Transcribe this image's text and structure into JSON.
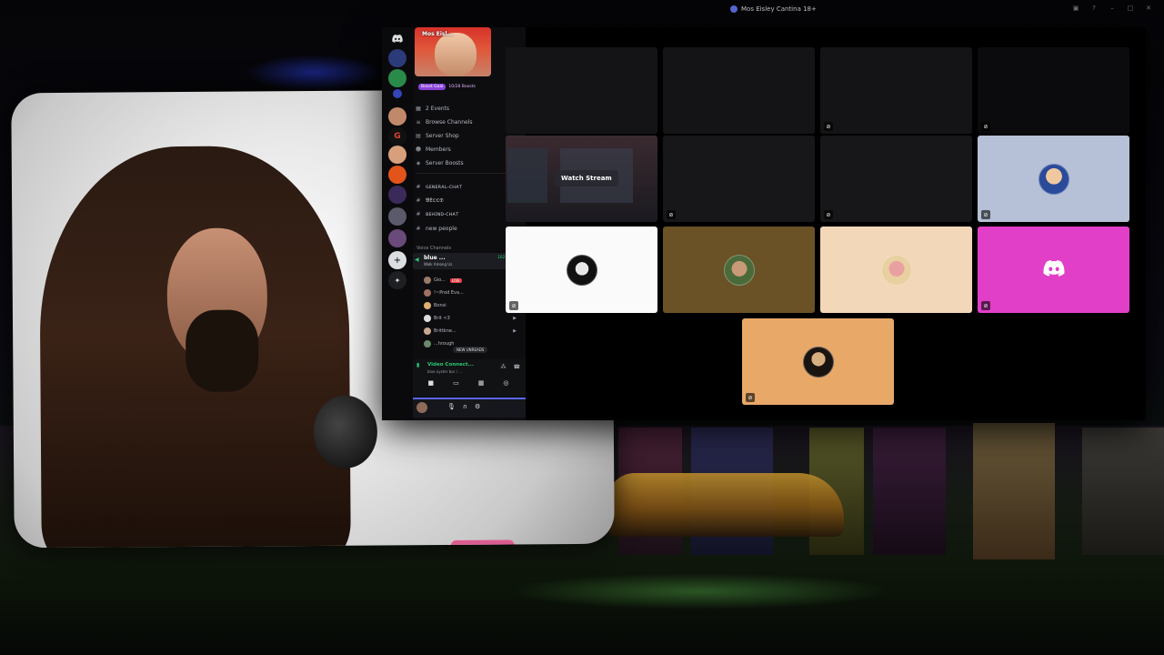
{
  "window": {
    "title": "Mos Eisley Cantina 18+"
  },
  "server": {
    "banner_name": "Mos Eisl...",
    "boost_goal": "Boost Goal",
    "boost_count": "10/28 Boosts"
  },
  "menu": [
    {
      "icon": "calendar-icon",
      "label": "2 Events"
    },
    {
      "icon": "browse-icon",
      "label": "Browse Channels"
    },
    {
      "icon": "shop-icon",
      "label": "Server Shop"
    },
    {
      "icon": "members-icon",
      "label": "Members"
    },
    {
      "icon": "boost-icon",
      "label": "Server Boosts"
    }
  ],
  "text_channels": [
    {
      "label": "ɢᴇɴᴇʀᴀʟ-ᴄʜᴀᴛ"
    },
    {
      "label": "𝕭𝕷𝕺𝕺𝕯"
    },
    {
      "label": "ʙᴇʜɪɴᴅ-ᴄʜᴀᴛ"
    },
    {
      "label": "new people"
    }
  ],
  "voice_section": {
    "title": "Voice Channels",
    "channel_name": "blue ...",
    "channel_sub": "Walk Among Us",
    "timer": "102:30:12"
  },
  "voice_users": [
    {
      "name": "Gio...",
      "live": "LIVE"
    },
    {
      "name": "!~Prod Eva..."
    },
    {
      "name": "Bonsi"
    },
    {
      "name": "Brit <3"
    },
    {
      "name": "Brittkne..."
    },
    {
      "name": "...hrough"
    }
  ],
  "new_unreads": "NEW UNREADS",
  "voice_status": {
    "title": "Video Connect...",
    "subtitle": "blue oyster bar / ..."
  },
  "grid": {
    "watch_stream": "Watch Stream"
  },
  "colors": {
    "accent": "#5865f2",
    "online": "#2dc770",
    "live": "#e23f44",
    "boost": "#8a44d8"
  }
}
